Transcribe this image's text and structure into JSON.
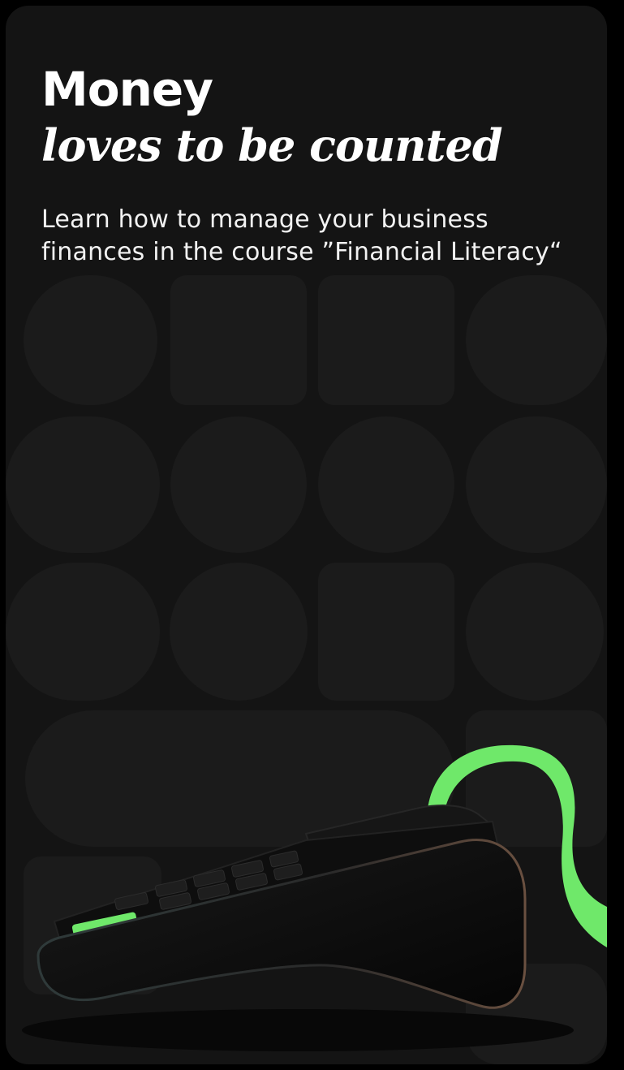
{
  "promo": {
    "headline_line1": "Money",
    "headline_line2": "loves to be counted",
    "subtitle": "Learn how to manage your business finances in the course ”Financial Literacy“"
  },
  "colors": {
    "card_background": "#141414",
    "pattern_shape": "#1c1c1c",
    "accent_green": "#6fe86a",
    "text": "#ffffff"
  },
  "illustration": {
    "icon": "payment-terminal-icon"
  }
}
